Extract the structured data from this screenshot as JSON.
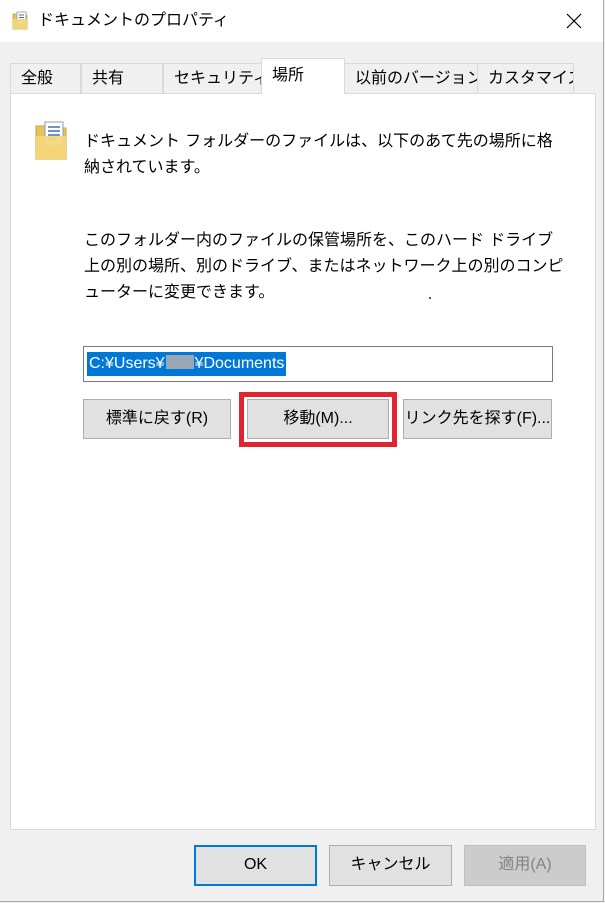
{
  "window": {
    "title": "ドキュメントのプロパティ",
    "close_label": "✕"
  },
  "tabs": [
    {
      "label": "全般",
      "active": false
    },
    {
      "label": "共有",
      "active": false
    },
    {
      "label": "セキュリティ",
      "active": false
    },
    {
      "label": "場所",
      "active": true
    },
    {
      "label": "以前のバージョン",
      "active": false
    },
    {
      "label": "カスタマイズ",
      "active": false
    }
  ],
  "location": {
    "description1": "ドキュメント フォルダーのファイルは、以下のあて先の場所に格納されています。",
    "description2": "このフォルダー内のファイルの保管場所を、このハード ドライブ上の別の場所、別のドライブ、またはネットワーク上の別のコンピューターに変更できます。",
    "path_prefix": "C:¥Users¥",
    "path_suffix": "¥Documents",
    "restore_label": "標準に戻す(R)",
    "move_label": "移動(M)...",
    "find_target_label": "リンク先を探す(F)..."
  },
  "footer": {
    "ok_label": "OK",
    "cancel_label": "キャンセル",
    "apply_label": "適用(A)"
  },
  "colors": {
    "selection": "#0078d7",
    "highlight": "#e02530"
  }
}
